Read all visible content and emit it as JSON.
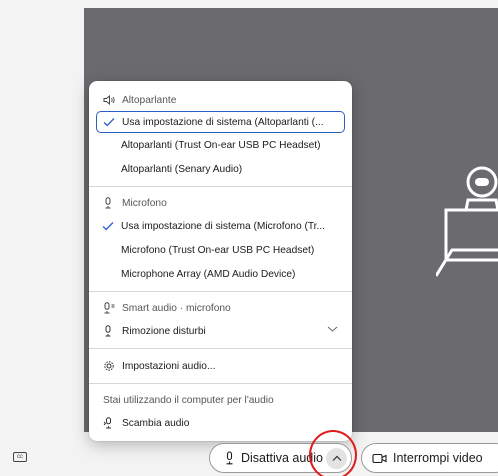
{
  "menu": {
    "speaker_header": "Altoparlante",
    "speaker_items": [
      "Usa impostazione di sistema (Altoparlanti (...",
      "Altoparlanti (Trust On-ear USB PC Headset)",
      "Altoparlanti (Senary Audio)"
    ],
    "mic_header": "Microfono",
    "mic_items": [
      "Usa impostazione di sistema (Microfono (Tr...",
      "Microfono (Trust On-ear USB PC Headset)",
      "Microphone Array (AMD Audio Device)"
    ],
    "smart_header": "Smart audio · microfono",
    "noise_label": "Rimozione disturbi",
    "settings_label": "Impostazioni audio...",
    "using_note": "Stai utilizzando il computer per l'audio",
    "switch_label": "Scambia audio"
  },
  "toolbar": {
    "mute_label": "Disattiva audio",
    "video_label": "Interrompi video",
    "cc_label": "cc"
  },
  "colors": {
    "accent": "#2a5fc9",
    "stage": "#6b6a6e",
    "highlight_circle": "#e21b1b"
  },
  "icons": {
    "speaker": "speaker-icon",
    "mic": "microphone-icon",
    "smart_mic": "smart-mic-icon",
    "gear": "gear-icon",
    "switch": "switch-audio-icon",
    "video": "video-camera-icon",
    "caret": "chevron-up-icon",
    "cc": "closed-captions-icon"
  }
}
